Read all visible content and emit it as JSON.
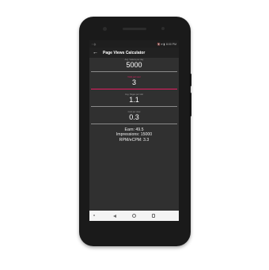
{
  "statusbar": {
    "left": "◦ ◎",
    "time": "8:00 PM",
    "icons": "🔇 ▾ ▮"
  },
  "appbar": {
    "back_icon": "←",
    "title": "Page Views Calculator"
  },
  "fields": [
    {
      "label": "Avg. Visitors per day",
      "value": "5000",
      "active": false
    },
    {
      "label": "Visits per user",
      "value": "3",
      "active": true
    },
    {
      "label": "Avg. Pages per visit",
      "value": "1.1",
      "active": false
    },
    {
      "label": "Cost per view",
      "value": "0.3",
      "active": false
    }
  ],
  "results": {
    "earn": "Earn: 49.5",
    "impressions": "Impressions: 15000",
    "rpm": "RPM/eCPM: 3.3"
  },
  "colors": {
    "accent": "#e91e63",
    "background": "#303030",
    "appbar": "#212121"
  },
  "navbar": {
    "icons": [
      "back-triangle",
      "home-circle",
      "recent-square"
    ]
  }
}
